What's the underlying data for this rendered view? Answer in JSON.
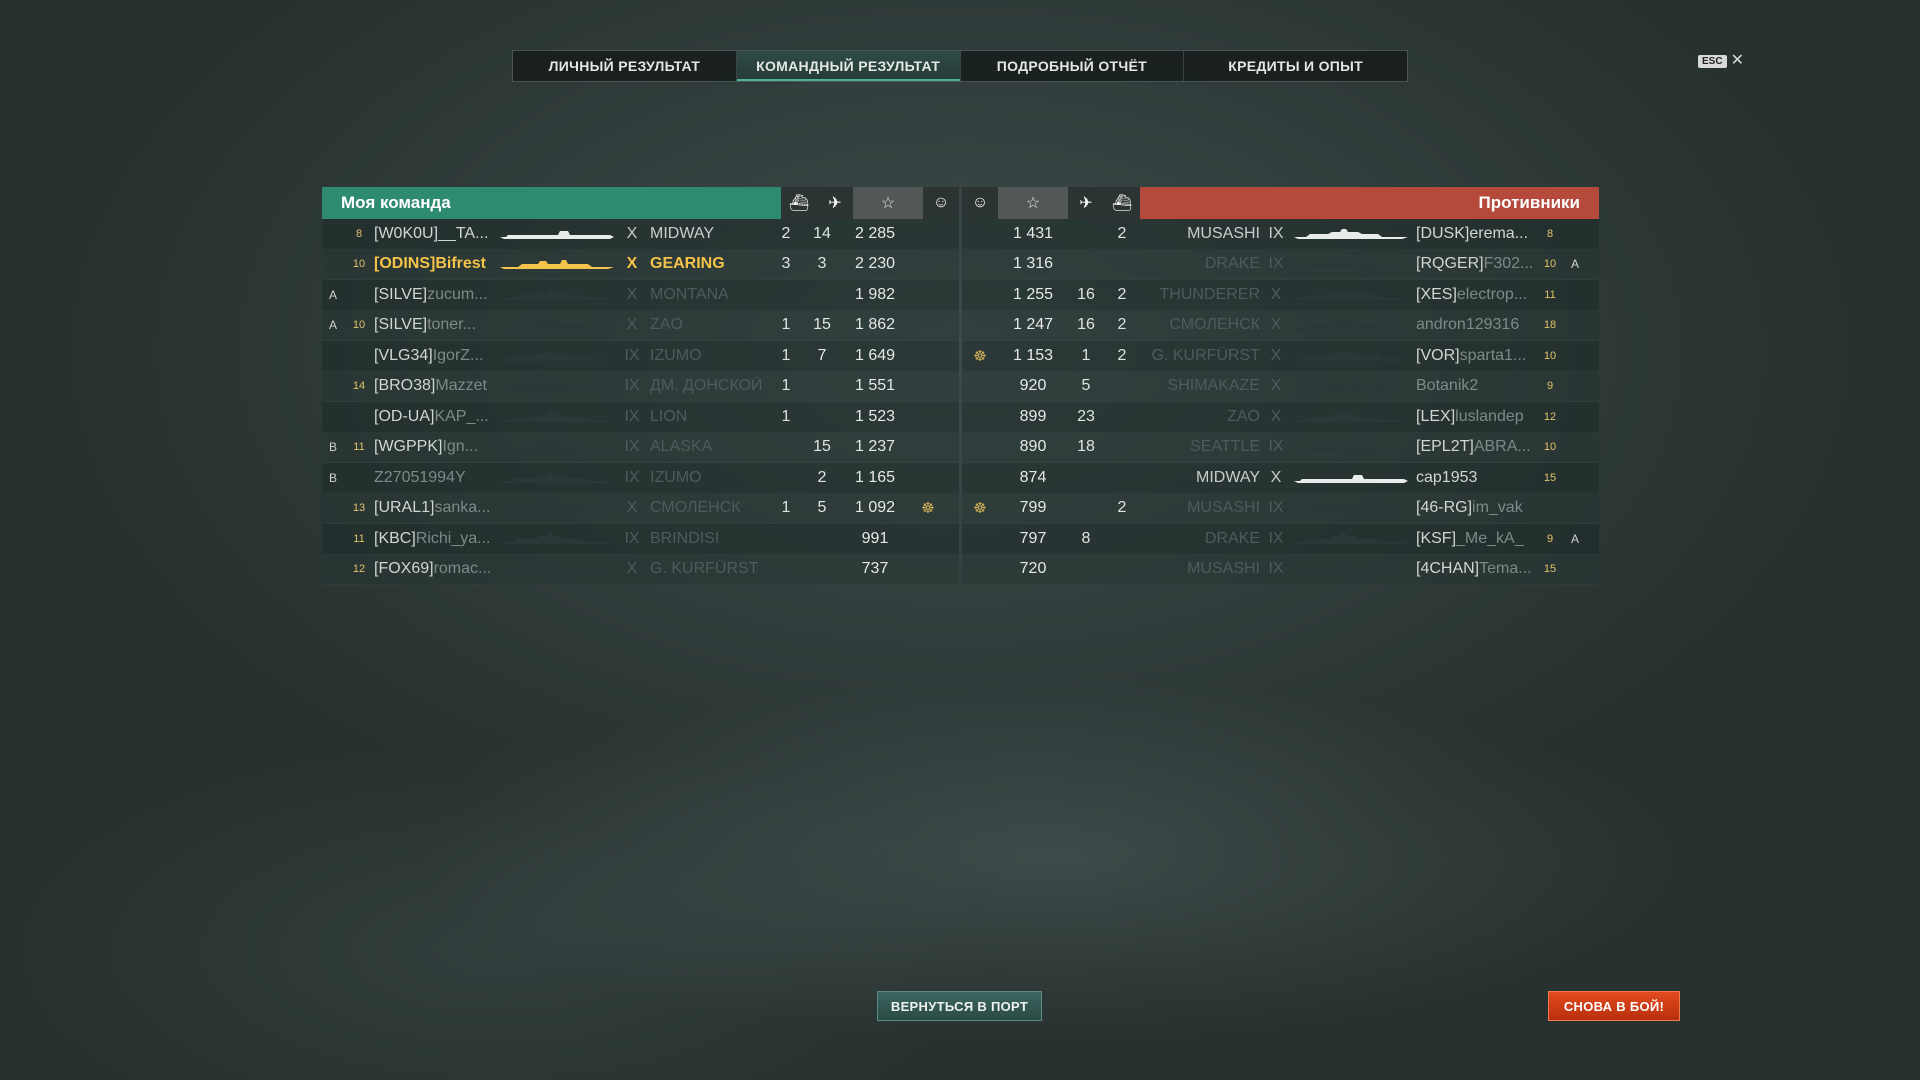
{
  "tabs": [
    {
      "label": "ЛИЧНЫЙ РЕЗУЛЬТАТ",
      "active": false
    },
    {
      "label": "КОМАНДНЫЙ РЕЗУЛЬТАТ",
      "active": true
    },
    {
      "label": "ПОДРОБНЫЙ ОТЧЁТ",
      "active": false
    },
    {
      "label": "КРЕДИТЫ И ОПЫТ",
      "active": false
    }
  ],
  "esc": {
    "key": "ESC",
    "close": "✕"
  },
  "header": {
    "my_team": "Моя команда",
    "enemies": "Противники",
    "icons": {
      "ships_destroyed": "ship-icon",
      "planes_destroyed": "plane-icon",
      "score": "star-icon",
      "medal": "medal-icon"
    }
  },
  "colors": {
    "ally": "#2f8a72",
    "enemy": "#b54a3c",
    "me": "#f4c34a",
    "battle_button": "#d0401a"
  },
  "my_team": [
    {
      "cap": "",
      "rank": "8",
      "clan": "[W0K0U]",
      "nick": "__TA...",
      "tier": "X",
      "ship": "MIDWAY",
      "kills": "2",
      "planes": "14",
      "score": "2 285",
      "medal": "",
      "alive": true,
      "me": false,
      "sil": "carrier"
    },
    {
      "cap": "",
      "rank": "10",
      "clan": "[ODINS]",
      "nick": "Bifrest",
      "tier": "X",
      "ship": "GEARING",
      "kills": "3",
      "planes": "3",
      "score": "2 230",
      "medal": "",
      "alive": true,
      "me": true,
      "sil": "destroyer"
    },
    {
      "cap": "A",
      "rank": "",
      "clan": "[SILVE]",
      "nick": "zucum...",
      "tier": "X",
      "ship": "MONTANA",
      "kills": "",
      "planes": "",
      "score": "1 982",
      "medal": "",
      "alive": false,
      "me": false,
      "sil": "battleship"
    },
    {
      "cap": "A",
      "rank": "10",
      "clan": "[SILVE]",
      "nick": "toner...",
      "tier": "X",
      "ship": "ZAO",
      "kills": "1",
      "planes": "15",
      "score": "1 862",
      "medal": "",
      "alive": false,
      "me": false,
      "sil": "cruiser"
    },
    {
      "cap": "",
      "rank": "",
      "clan": "[VLG34]",
      "nick": "IgorZ...",
      "tier": "IX",
      "ship": "IZUMO",
      "kills": "1",
      "planes": "7",
      "score": "1 649",
      "medal": "",
      "alive": false,
      "me": false,
      "sil": "battleship"
    },
    {
      "cap": "",
      "rank": "14",
      "clan": "[BRO38]",
      "nick": "Mazzet",
      "tier": "IX",
      "ship": "ДМ. ДОНСКОЙ",
      "kills": "1",
      "planes": "",
      "score": "1 551",
      "medal": "",
      "alive": false,
      "me": false,
      "sil": "cruiser"
    },
    {
      "cap": "",
      "rank": "",
      "clan": "[OD-UA]",
      "nick": "KAP_...",
      "tier": "IX",
      "ship": "LION",
      "kills": "1",
      "planes": "",
      "score": "1 523",
      "medal": "",
      "alive": false,
      "me": false,
      "sil": "battleship"
    },
    {
      "cap": "B",
      "rank": "11",
      "clan": "[WGPPK]",
      "nick": "Ign...",
      "tier": "IX",
      "ship": "ALASKA",
      "kills": "",
      "planes": "15",
      "score": "1 237",
      "medal": "",
      "alive": false,
      "me": false,
      "sil": "cruiser"
    },
    {
      "cap": "B",
      "rank": "",
      "clan": "",
      "nick": "Z27051994Y",
      "tier": "IX",
      "ship": "IZUMO",
      "kills": "",
      "planes": "2",
      "score": "1 165",
      "medal": "",
      "alive": false,
      "me": false,
      "sil": "battleship"
    },
    {
      "cap": "",
      "rank": "13",
      "clan": "[URAL1]",
      "nick": "sanka...",
      "tier": "X",
      "ship": "СМОЛЕНСК",
      "kills": "1",
      "planes": "5",
      "score": "1 092",
      "medal": "☸",
      "alive": false,
      "me": false,
      "sil": "cruiser"
    },
    {
      "cap": "",
      "rank": "11",
      "clan": "[KBC]",
      "nick": "Richi_ya...",
      "tier": "IX",
      "ship": "BRINDISI",
      "kills": "",
      "planes": "",
      "score": "991",
      "medal": "",
      "alive": false,
      "me": false,
      "sil": "cruiser"
    },
    {
      "cap": "",
      "rank": "12",
      "clan": "[FOX69]",
      "nick": "romac...",
      "tier": "X",
      "ship": "G. KURFÜRST",
      "kills": "",
      "planes": "",
      "score": "737",
      "medal": "",
      "alive": false,
      "me": false,
      "sil": "battleship"
    }
  ],
  "enemies": [
    {
      "medal": "",
      "score": "1 431",
      "planes": "",
      "kills": "2",
      "ship": "MUSASHI",
      "tier": "IX",
      "clan": "[DUSK]",
      "nick": "erema...",
      "rank": "8",
      "cap": "",
      "alive": true,
      "sil": "battleship"
    },
    {
      "medal": "",
      "score": "1 316",
      "planes": "",
      "kills": "",
      "ship": "DRAKE",
      "tier": "IX",
      "clan": "[RQGER]",
      "nick": "F302...",
      "rank": "10",
      "cap": "A",
      "alive": false,
      "sil": "cruiser"
    },
    {
      "medal": "",
      "score": "1 255",
      "planes": "16",
      "kills": "2",
      "ship": "THUNDERER",
      "tier": "X",
      "clan": "[XES]",
      "nick": "electrop...",
      "rank": "11",
      "cap": "",
      "alive": false,
      "sil": "battleship"
    },
    {
      "medal": "",
      "score": "1 247",
      "planes": "16",
      "kills": "2",
      "ship": "СМОЛЕНСК",
      "tier": "X",
      "clan": "",
      "nick": "andron129316",
      "rank": "18",
      "cap": "",
      "alive": false,
      "sil": "cruiser"
    },
    {
      "medal": "☸",
      "score": "1 153",
      "planes": "1",
      "kills": "2",
      "ship": "G. KURFÜRST",
      "tier": "X",
      "clan": "[VOR]",
      "nick": "sparta1...",
      "rank": "10",
      "cap": "",
      "alive": false,
      "sil": "battleship"
    },
    {
      "medal": "",
      "score": "920",
      "planes": "5",
      "kills": "",
      "ship": "SHIMAKAZE",
      "tier": "X",
      "clan": "",
      "nick": "Botanik2",
      "rank": "9",
      "cap": "",
      "alive": false,
      "sil": "destroyer"
    },
    {
      "medal": "",
      "score": "899",
      "planes": "23",
      "kills": "",
      "ship": "ZAO",
      "tier": "X",
      "clan": "[LEX]",
      "nick": "luslandep",
      "rank": "12",
      "cap": "",
      "alive": false,
      "sil": "cruiser"
    },
    {
      "medal": "",
      "score": "890",
      "planes": "18",
      "kills": "",
      "ship": "SEATTLE",
      "tier": "IX",
      "clan": "[EPL2T]",
      "nick": "ABRA...",
      "rank": "10",
      "cap": "",
      "alive": false,
      "sil": "cruiser"
    },
    {
      "medal": "",
      "score": "874",
      "planes": "",
      "kills": "",
      "ship": "MIDWAY",
      "tier": "X",
      "clan": "",
      "nick": "cap1953",
      "rank": "15",
      "cap": "",
      "alive": true,
      "sil": "carrier"
    },
    {
      "medal": "☸",
      "score": "799",
      "planes": "",
      "kills": "2",
      "ship": "MUSASHI",
      "tier": "IX",
      "clan": "[46-RG]",
      "nick": "im_vak",
      "rank": "",
      "cap": "",
      "alive": false,
      "sil": "battleship"
    },
    {
      "medal": "",
      "score": "797",
      "planes": "8",
      "kills": "",
      "ship": "DRAKE",
      "tier": "IX",
      "clan": "[KSF]",
      "nick": "_Me_kA_",
      "rank": "9",
      "cap": "A",
      "alive": false,
      "sil": "cruiser"
    },
    {
      "medal": "",
      "score": "720",
      "planes": "",
      "kills": "",
      "ship": "MUSASHI",
      "tier": "IX",
      "clan": "[4CHAN]",
      "nick": "Tema...",
      "rank": "15",
      "cap": "",
      "alive": false,
      "sil": "battleship"
    }
  ],
  "buttons": {
    "port": "ВЕРНУТЬСЯ В ПОРТ",
    "battle": "СНОВА В БОЙ!"
  }
}
